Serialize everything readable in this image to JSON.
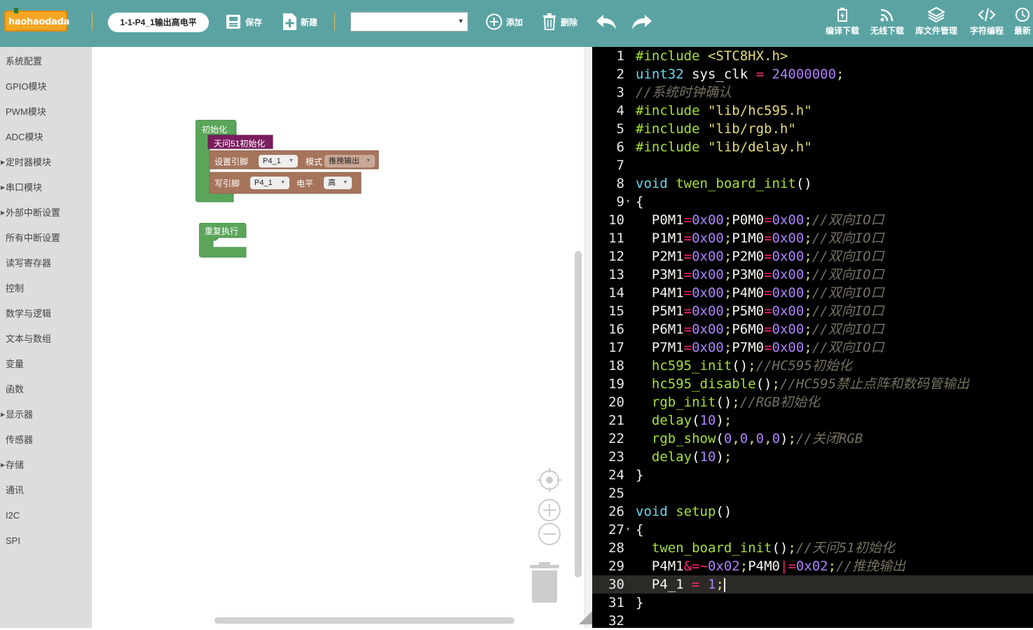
{
  "app": {
    "logo_text": "haohaodada"
  },
  "toolbar": {
    "filename": "1-1-P4_1输出高电平",
    "save_label": "保存",
    "new_label": "新建",
    "add_label": "添加",
    "delete_label": "删除",
    "select_value": "",
    "right_buttons": [
      "编译下载",
      "无线下载",
      "库文件管理",
      "字符编程",
      "最新"
    ]
  },
  "sidebar": {
    "items": [
      {
        "label": "系统配置",
        "arrow": false
      },
      {
        "label": "GPIO模块",
        "arrow": false
      },
      {
        "label": "PWM模块",
        "arrow": false
      },
      {
        "label": "ADC模块",
        "arrow": false
      },
      {
        "label": "定时器模块",
        "arrow": true
      },
      {
        "label": "串口模块",
        "arrow": true
      },
      {
        "label": "外部中断设置",
        "arrow": true
      },
      {
        "label": "所有中断设置",
        "arrow": false
      },
      {
        "label": "读写寄存器",
        "arrow": false
      },
      {
        "label": "控制",
        "arrow": false
      },
      {
        "label": "数学与逻辑",
        "arrow": false
      },
      {
        "label": "文本与数组",
        "arrow": false
      },
      {
        "label": "变量",
        "arrow": false
      },
      {
        "label": "函数",
        "arrow": false
      },
      {
        "label": "显示器",
        "arrow": true
      },
      {
        "label": "传感器",
        "arrow": false
      },
      {
        "label": "存储",
        "arrow": true
      },
      {
        "label": "通讯",
        "arrow": false
      },
      {
        "label": "I2C",
        "arrow": false
      },
      {
        "label": "SPI",
        "arrow": false
      }
    ]
  },
  "blocks": {
    "init_label": "初始化",
    "board_init_label": "天问51初始化",
    "set_pin_label": "设置引脚",
    "set_pin_value": "P4_1",
    "mode_label": "模式",
    "mode_value": "推挽输出",
    "write_pin_label": "写引脚",
    "write_pin_value": "P4_1",
    "level_label": "电平",
    "level_value": "高",
    "loop_label": "重复执行"
  },
  "colors": {
    "toolbar": "#5ba3a3",
    "block_green": "#5ba55b",
    "block_maroon": "#7b1d5f",
    "block_brown": "#a5745b",
    "editor_bg": "#000000"
  },
  "editor": {
    "active_line": 30,
    "lines": [
      {
        "n": "1",
        "html": "<span class='pre'>#include</span> <span class='str'>&lt;STC8HX.h&gt;</span>"
      },
      {
        "n": "2",
        "html": "<span class='kw'>uint32</span> sys_clk <span class='op'>=</span> <span class='num'>24000000</span><span class='str'>;</span>"
      },
      {
        "n": "3",
        "html": "<span class='cmt'>//系统时钟确认</span>"
      },
      {
        "n": "4",
        "html": "<span class='pre'>#include</span> <span class='str'>\"lib/hc595.h\"</span>"
      },
      {
        "n": "5",
        "html": "<span class='pre'>#include</span> <span class='str'>\"lib/rgb.h\"</span>"
      },
      {
        "n": "6",
        "html": "<span class='pre'>#include</span> <span class='str'>\"lib/delay.h\"</span>"
      },
      {
        "n": "7",
        "html": ""
      },
      {
        "n": "8",
        "html": "<span class='kw'>void</span> <span class='fn'>twen_board_init</span>()"
      },
      {
        "n": "9",
        "html": "{",
        "fold": true
      },
      {
        "n": "10",
        "html": "  P0M1<span class='op'>=</span><span class='num'>0x00</span><span class='str'>;</span>P0M0<span class='op'>=</span><span class='num'>0x00</span><span class='str'>;</span><span class='cmt'>//双向IO口</span>"
      },
      {
        "n": "11",
        "html": "  P1M1<span class='op'>=</span><span class='num'>0x00</span><span class='str'>;</span>P1M0<span class='op'>=</span><span class='num'>0x00</span><span class='str'>;</span><span class='cmt'>//双向IO口</span>"
      },
      {
        "n": "12",
        "html": "  P2M1<span class='op'>=</span><span class='num'>0x00</span><span class='str'>;</span>P2M0<span class='op'>=</span><span class='num'>0x00</span><span class='str'>;</span><span class='cmt'>//双向IO口</span>"
      },
      {
        "n": "13",
        "html": "  P3M1<span class='op'>=</span><span class='num'>0x00</span><span class='str'>;</span>P3M0<span class='op'>=</span><span class='num'>0x00</span><span class='str'>;</span><span class='cmt'>//双向IO口</span>"
      },
      {
        "n": "14",
        "html": "  P4M1<span class='op'>=</span><span class='num'>0x00</span><span class='str'>;</span>P4M0<span class='op'>=</span><span class='num'>0x00</span><span class='str'>;</span><span class='cmt'>//双向IO口</span>"
      },
      {
        "n": "15",
        "html": "  P5M1<span class='op'>=</span><span class='num'>0x00</span><span class='str'>;</span>P5M0<span class='op'>=</span><span class='num'>0x00</span><span class='str'>;</span><span class='cmt'>//双向IO口</span>"
      },
      {
        "n": "16",
        "html": "  P6M1<span class='op'>=</span><span class='num'>0x00</span><span class='str'>;</span>P6M0<span class='op'>=</span><span class='num'>0x00</span><span class='str'>;</span><span class='cmt'>//双向IO口</span>"
      },
      {
        "n": "17",
        "html": "  P7M1<span class='op'>=</span><span class='num'>0x00</span><span class='str'>;</span>P7M0<span class='op'>=</span><span class='num'>0x00</span><span class='str'>;</span><span class='cmt'>//双向IO口</span>"
      },
      {
        "n": "18",
        "html": "  <span class='fn'>hc595_init</span>()<span class='str'>;</span><span class='cmt'>//HC595初始化</span>"
      },
      {
        "n": "19",
        "html": "  <span class='fn'>hc595_disable</span>()<span class='str'>;</span><span class='cmt'>//HC595禁止点阵和数码管输出</span>"
      },
      {
        "n": "20",
        "html": "  <span class='fn'>rgb_init</span>()<span class='str'>;</span><span class='cmt'>//RGB初始化</span>"
      },
      {
        "n": "21",
        "html": "  <span class='fn'>delay</span>(<span class='num'>10</span>)<span class='str'>;</span>"
      },
      {
        "n": "22",
        "html": "  <span class='fn'>rgb_show</span>(<span class='num'>0</span><span class='str'>,</span><span class='num'>0</span><span class='str'>,</span><span class='num'>0</span><span class='str'>,</span><span class='num'>0</span>)<span class='str'>;</span><span class='cmt'>//关闭RGB</span>"
      },
      {
        "n": "23",
        "html": "  <span class='fn'>delay</span>(<span class='num'>10</span>)<span class='str'>;</span>"
      },
      {
        "n": "24",
        "html": "}"
      },
      {
        "n": "25",
        "html": ""
      },
      {
        "n": "26",
        "html": "<span class='kw'>void</span> <span class='fn'>setup</span>()"
      },
      {
        "n": "27",
        "html": "{",
        "fold": true
      },
      {
        "n": "28",
        "html": "  <span class='fn'>twen_board_init</span>()<span class='str'>;</span><span class='cmt'>//天问51初始化</span>"
      },
      {
        "n": "29",
        "html": "  P4M1<span class='op'>&amp;=~</span><span class='num'>0x02</span><span class='str'>;</span>P4M0<span class='op'>|=</span><span class='num'>0x02</span><span class='str'>;</span><span class='cmt'>//推挽输出</span>"
      },
      {
        "n": "30",
        "html": "  P4_1 <span class='op'>=</span> <span class='num'>1</span><span class='str'>;</span><span class='cursor'></span>"
      },
      {
        "n": "31",
        "html": "}"
      },
      {
        "n": "32",
        "html": ""
      }
    ]
  }
}
